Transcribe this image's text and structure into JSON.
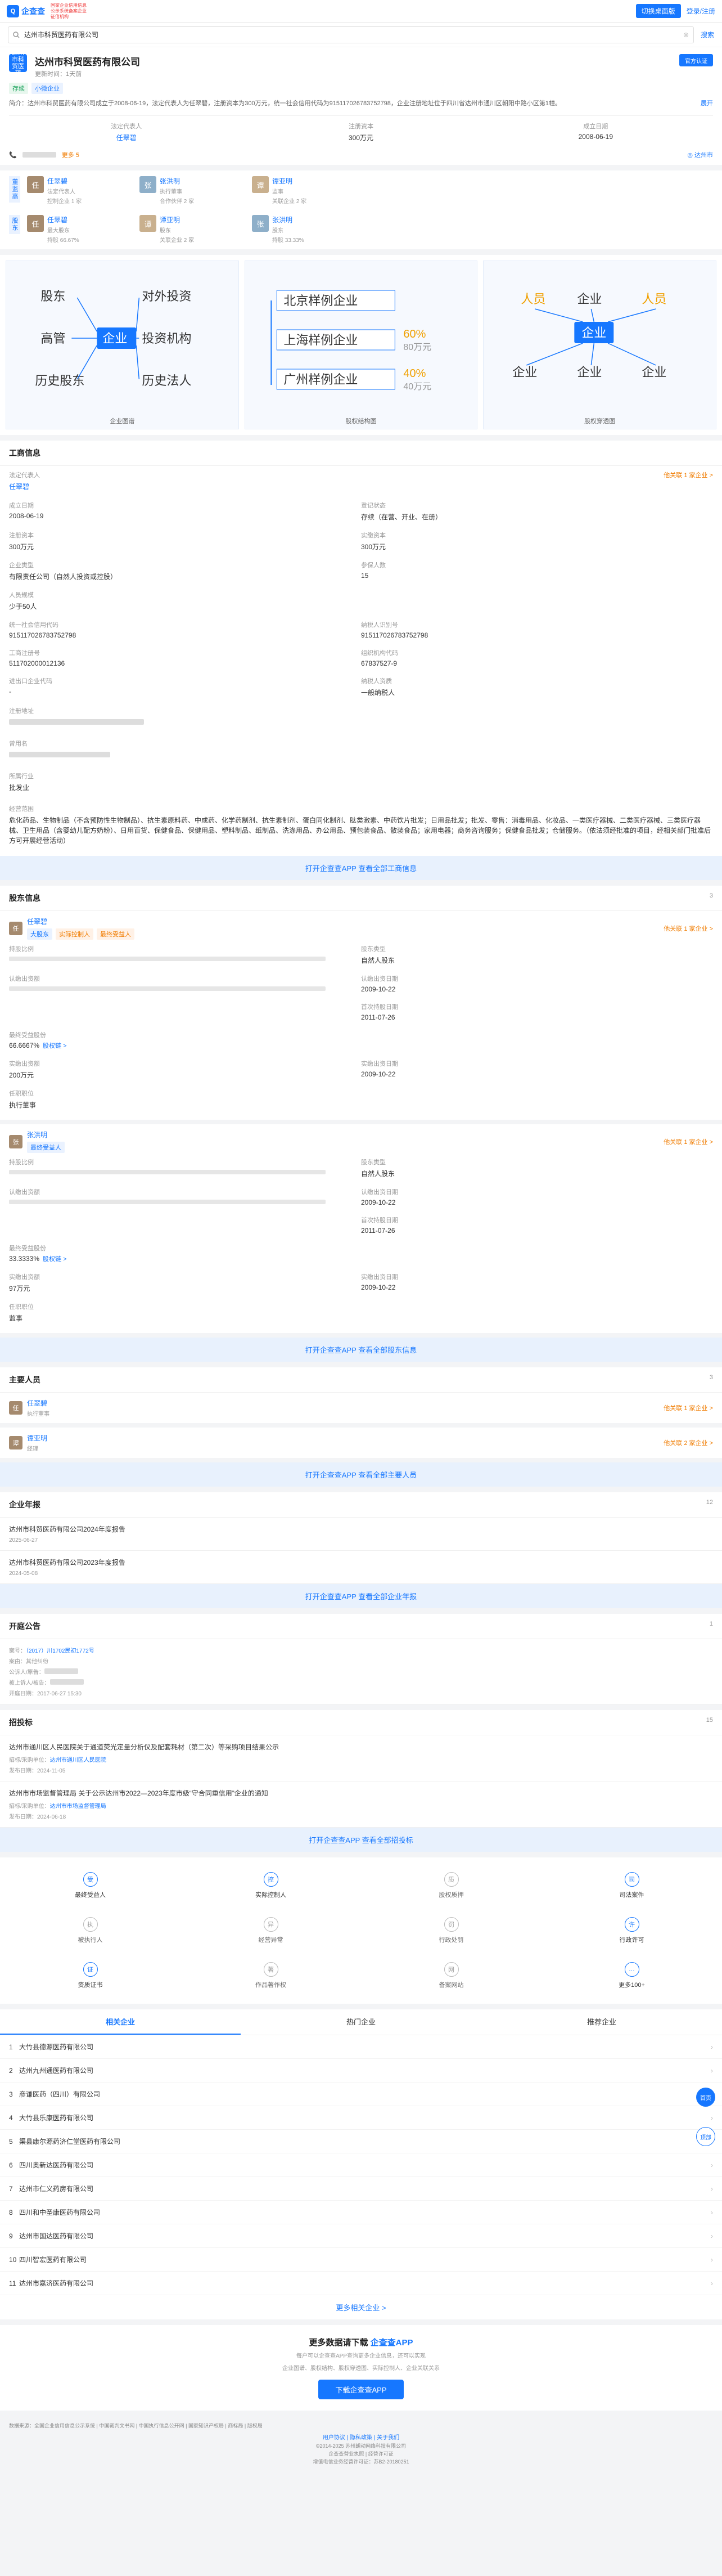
{
  "topbar": {
    "logo": "企查查",
    "logo_sub": "国家企业信用信息公示系统备案企业征信机构",
    "btn": "切换桌面版",
    "login": "登录/注册"
  },
  "search": {
    "value": "达州市科贸医药有限公司"
  },
  "company": {
    "name": "达州市科贸医药有限公司",
    "updated": "更新时间：1天前",
    "tags": [
      "存续",
      "小微企业"
    ],
    "logo_text": "达州市科贸医药",
    "intro_label": "简介：",
    "intro": "达州市科贸医药有限公司成立于2008-06-19，法定代表人为任翠碧，注册资本为300万元，统一社会信用代码为915117026783752798，企业注册地址位于四川省达州市通川区朝阳中路小区第1幢。",
    "intro_more": "展开",
    "kv": [
      {
        "k": "法定代表人",
        "v": "任翠碧"
      },
      {
        "k": "注册资本",
        "v": "300万元"
      },
      {
        "k": "成立日期",
        "v": "2008-06-19"
      }
    ],
    "phone_more": "更多 5",
    "city": "达州市",
    "claim": "官方认证"
  },
  "related": {
    "label1": "董监高",
    "label2": "股东",
    "people1": [
      {
        "name": "任翠碧",
        "meta": "法定代表人",
        "meta2": "控制企业 1 家"
      },
      {
        "name": "张洪明",
        "meta": "执行董事",
        "meta2": "合作伙伴 2 家"
      },
      {
        "name": "谭亚明",
        "meta": "监事",
        "meta2": "关联企业 2 家"
      }
    ],
    "people2": [
      {
        "name": "任翠碧",
        "meta": "最大股东",
        "meta2": "持股 66.67%"
      },
      {
        "name": "谭亚明",
        "meta": "股东",
        "meta2": "关联企业 2 家"
      },
      {
        "name": "张洪明",
        "meta": "股东",
        "meta2": "持股 33.33%"
      }
    ]
  },
  "graphs": {
    "g1": {
      "cap": "企业图谱",
      "nodes": [
        "股东",
        "对外投资",
        "高管",
        "企业",
        "投资机构",
        "历史股东",
        "历史法人"
      ]
    },
    "g2": {
      "cap": "股权结构图",
      "rows": [
        {
          "name": "北京样例企业",
          "p": ""
        },
        {
          "name": "上海样例企业",
          "p": "60%",
          "amt": "80万元"
        },
        {
          "name": "广州样例企业",
          "p": "40%",
          "amt": "40万元"
        }
      ]
    },
    "g3": {
      "cap": "股权穿透图",
      "top": [
        "人员",
        "企业",
        "人员"
      ],
      "center": "企业",
      "bottom": [
        "企业",
        "企业",
        "企业"
      ]
    }
  },
  "gsxx": {
    "title": "工商信息",
    "legal_k": "法定代表人",
    "legal_v": "任翠碧",
    "legal_rt": "他关联 1 家企业 >",
    "items": [
      {
        "k": "成立日期",
        "v": "2008-06-19"
      },
      {
        "k": "登记状态",
        "v": "存续（在营、开业、在册）"
      },
      {
        "k": "注册资本",
        "v": "300万元"
      },
      {
        "k": "实缴资本",
        "v": "300万元"
      },
      {
        "k": "企业类型",
        "v": "有限责任公司（自然人投资或控股）"
      },
      {
        "k": "参保人数",
        "v": "15"
      },
      {
        "k": "人员规模",
        "v": "少于50人"
      },
      {
        "k": "",
        "v": ""
      },
      {
        "k": "统一社会信用代码",
        "v": "915117026783752798"
      },
      {
        "k": "纳税人识别号",
        "v": "915117026783752798"
      },
      {
        "k": "工商注册号",
        "v": "511702000012136"
      },
      {
        "k": "组织机构代码",
        "v": "67837527-9"
      },
      {
        "k": "进出口企业代码",
        "v": "-"
      },
      {
        "k": "纳税人资质",
        "v": "一般纳税人"
      }
    ],
    "addr_k": "注册地址",
    "name_k": "曾用名",
    "ind_k": "所属行业",
    "ind_v": "批发业",
    "scope_k": "经营范围",
    "scope_v": "危化药品、生物制品（不含预防性生物制品）、抗生素原料药、中成药、化学药制剂、抗生素制剂、蛋白同化制剂、肽类激素、中药饮片批发；日用品批发；批发、零售：消毒用品、化妆品、一类医疗器械、二类医疗器械、三类医疗器械、卫生用品（含婴幼儿配方奶粉）、日用百货、保健食品、保健用品、塑料制品、纸制品、洗涤用品、办公用品、预包装食品、散装食品；家用电器；商务咨询服务；保健食品批发；仓储服务。（依法须经批准的项目，经相关部门批准后方可开展经营活动）",
    "cta": "打开企查查APP 查看全部工商信息"
  },
  "gdxx": {
    "title": "股东信息",
    "count": "3",
    "holders": [
      {
        "abbr": "任",
        "name": "任翠碧",
        "tags": [
          "大股东",
          "实际控制人",
          "最终受益人"
        ],
        "rt": "他关联 1 家企业 >",
        "rows": [
          {
            "k": "持股比例",
            "v": ""
          },
          {
            "k": "股东类型",
            "v": "自然人股东"
          },
          {
            "k": "认缴出资额",
            "v": ""
          },
          {
            "k": "认缴出资日期",
            "v": "2009-10-22"
          },
          {
            "k": "",
            "v": ""
          },
          {
            "k": "首次持股日期",
            "v": "2011-07-26"
          },
          {
            "k": "最终受益股份",
            "v": "66.6667%",
            "link": "股权链 >"
          },
          {
            "k": "",
            "v": ""
          },
          {
            "k": "实缴出资额",
            "v": "200万元"
          },
          {
            "k": "实缴出资日期",
            "v": "2009-10-22"
          },
          {
            "k": "任职职位",
            "v": "执行董事"
          },
          {
            "k": "",
            "v": ""
          }
        ]
      },
      {
        "abbr": "张",
        "name": "张洪明",
        "tags": [
          "最终受益人"
        ],
        "rt": "他关联 1 家企业 >",
        "rows": [
          {
            "k": "持股比例",
            "v": ""
          },
          {
            "k": "股东类型",
            "v": "自然人股东"
          },
          {
            "k": "认缴出资额",
            "v": ""
          },
          {
            "k": "认缴出资日期",
            "v": "2009-10-22"
          },
          {
            "k": "",
            "v": ""
          },
          {
            "k": "首次持股日期",
            "v": "2011-07-26"
          },
          {
            "k": "最终受益股份",
            "v": "33.3333%",
            "link": "股权链 >"
          },
          {
            "k": "",
            "v": ""
          },
          {
            "k": "实缴出资额",
            "v": "97万元"
          },
          {
            "k": "实缴出资日期",
            "v": "2009-10-22"
          },
          {
            "k": "任职职位",
            "v": "监事"
          },
          {
            "k": "",
            "v": ""
          }
        ]
      }
    ],
    "cta": "打开企查查APP 查看全部股东信息"
  },
  "zyry": {
    "title": "主要人员",
    "count": "3",
    "people": [
      {
        "abbr": "任",
        "name": "任翠碧",
        "role": "执行董事",
        "rt": "他关联 1 家企业 >"
      },
      {
        "abbr": "谭",
        "name": "谭亚明",
        "role": "经理",
        "rt": "他关联 2 家企业 >"
      }
    ],
    "cta": "打开企查查APP 查看全部主要人员"
  },
  "qynb": {
    "title": "企业年报",
    "count": "12",
    "items": [
      {
        "t": "达州市科贸医药有限公司2024年度报告",
        "d": "2025-06-27"
      },
      {
        "t": "达州市科贸医药有限公司2023年度报告",
        "d": "2024-05-08"
      }
    ],
    "cta": "打开企查查APP 查看全部企业年报"
  },
  "ktgg": {
    "title": "开庭公告",
    "count": "1",
    "case_k": "案号：",
    "case_v": "（2017）川1702民初1772号",
    "reason": "案由：其他纠纷",
    "party1": "公诉人/原告：",
    "party2": "被上诉人/被告：",
    "date": "开庭日期：2017-06-27 15:30"
  },
  "zhb": {
    "title": "招投标",
    "count": "15",
    "items": [
      {
        "t": "达州市通川区人民医院关于通道荧光定量分析仪及配套耗材（第二次）等采购项目结果公示",
        "s1k": "招标/采购单位：",
        "s1v": "达州市通川区人民医院",
        "s2": "发布日期：2024-11-05"
      },
      {
        "t": "达州市市场监督管理局 关于公示达州市2022—2023年度市级“守合同重信用”企业的通知",
        "s1k": "招标/采购单位：",
        "s1v": "达州市市场监督管理局",
        "s2": "发布日期：2024-06-18"
      }
    ],
    "cta": "打开企查查APP 查看全部招投标"
  },
  "features": [
    {
      "label": "最终受益人",
      "icon": "受",
      "active": true
    },
    {
      "label": "实际控制人",
      "icon": "控",
      "active": true
    },
    {
      "label": "股权质押",
      "icon": "质",
      "active": false
    },
    {
      "label": "司法案件",
      "icon": "司",
      "active": true
    },
    {
      "label": "被执行人",
      "icon": "执",
      "active": false
    },
    {
      "label": "经营异常",
      "icon": "异",
      "active": false
    },
    {
      "label": "行政处罚",
      "icon": "罚",
      "active": false
    },
    {
      "label": "行政许可",
      "icon": "许",
      "active": true
    },
    {
      "label": "资质证书",
      "icon": "证",
      "active": true
    },
    {
      "label": "作品著作权",
      "icon": "著",
      "active": false
    },
    {
      "label": "备案网站",
      "icon": "网",
      "active": false
    },
    {
      "label": "更多100+",
      "icon": "…",
      "active": true
    }
  ],
  "float": {
    "home": "首页",
    "top": "顶部"
  },
  "tabs": [
    "相关企业",
    "热门企业",
    "推荐企业"
  ],
  "rel": [
    "大竹县德源医药有限公司",
    "达州九州通医药有限公司",
    "彦谦医药（四川）有限公司",
    "大竹县乐康医药有限公司",
    "渠县康尔源药济仁堂医药有限公司",
    "四川奥新达医药有限公司",
    "达州市仁义药房有限公司",
    "四川和中圣康医药有限公司",
    "达州市国达医药有限公司",
    "四川智宏医药有限公司",
    "达州市嘉济医药有限公司"
  ],
  "rel_more": "更多相关企业 >",
  "footer_cta": {
    "t1": "更多数据请下载",
    "t2": "企查查APP",
    "s1": "每户可以企查查APP查询更多企业信息，还可以实现",
    "s2": "企业图谱、股权结构、股权穿透图、实际控制人、企业关联关系",
    "btn": "下载企查查APP"
  },
  "page_footer": {
    "line1": "数据来源：全国企业信用信息公示系统 | 中国裁判文书网 | 中国执行信息公开网 | 国家知识产权局 | 商标局 | 版权局",
    "links": "用户协议  |  隐私政策  |  关于我们",
    "c1": "©2014-2025 苏州朗动网络科技有限公司",
    "c2": "企查查营业执照 | 经营许可证",
    "c3": "增值电信业务经营许可证：苏B2-20180251"
  }
}
